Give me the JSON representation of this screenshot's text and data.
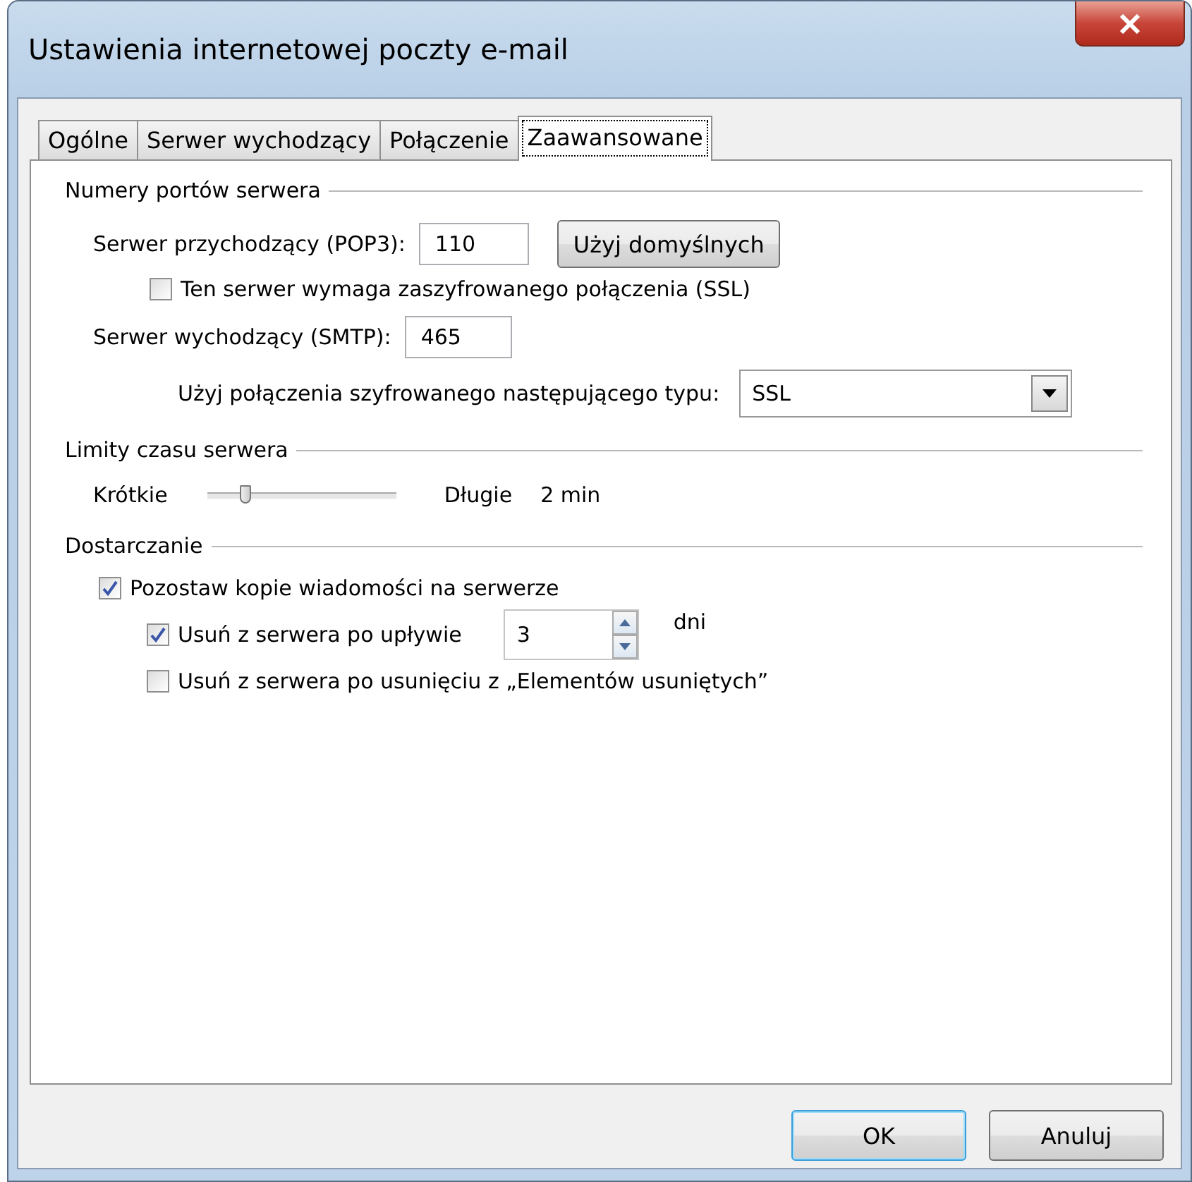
{
  "window": {
    "title": "Ustawienia internetowej poczty e-mail"
  },
  "tabs": [
    {
      "label": "Ogólne",
      "selected": false
    },
    {
      "label": "Serwer wychodzący",
      "selected": false
    },
    {
      "label": "Połączenie",
      "selected": false
    },
    {
      "label": "Zaawansowane",
      "selected": true
    }
  ],
  "ports": {
    "heading": "Numery portów serwera",
    "incoming_label": "Serwer przychodzący (POP3):",
    "incoming_value": "110",
    "default_button": "Użyj domyślnych",
    "ssl_checkbox": {
      "label": "Ten serwer wymaga zaszyfrowanego połączenia (SSL)",
      "checked": false
    },
    "outgoing_label": "Serwer wychodzący (SMTP):",
    "outgoing_value": "465",
    "encryption_label": "Użyj połączenia szyfrowanego następującego typu:",
    "encryption_value": "SSL"
  },
  "timeouts": {
    "heading": "Limity czasu serwera",
    "min_label": "Krótkie",
    "max_label": "Długie",
    "level": 0.2,
    "reading": "2 min"
  },
  "delivery": {
    "heading": "Dostarczanie",
    "leave_copy": {
      "label": "Pozostaw kopie wiadomości na serwerze",
      "checked": true
    },
    "remove_after": {
      "label": "Usuń z serwera po upływie",
      "checked": true,
      "value": "3",
      "unit": "dni"
    },
    "remove_deleted": {
      "label": "Usuń z serwera po usunięciu z „Elementów usuniętych”",
      "checked": false
    }
  },
  "buttons": [
    {
      "label": "OK",
      "selected": true
    },
    {
      "label": "Anuluj",
      "selected": false
    }
  ]
}
